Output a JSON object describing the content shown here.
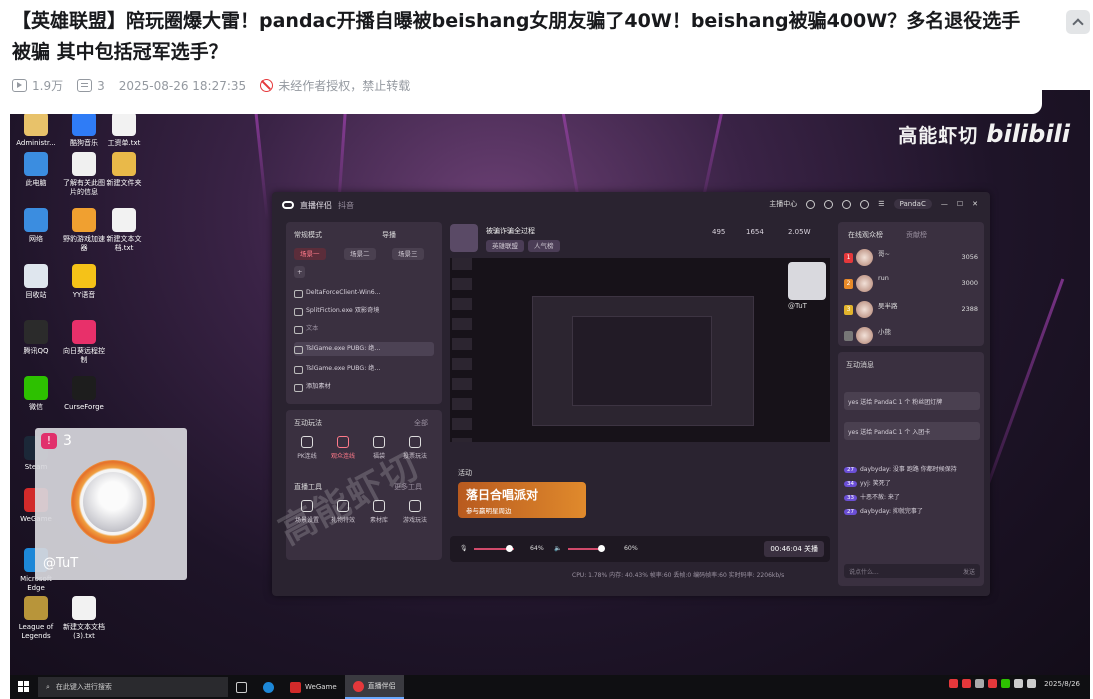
{
  "article": {
    "title": "【英雄联盟】陪玩圈爆大雷！pandac开播自曝被beishang女朋友骗了40W！beishang被骗400W？多名退役选手被骗 其中包括冠军选手？",
    "views": "1.9万",
    "danmaku_count": "3",
    "published": "2025-08-26 18:27:35",
    "copyright_notice": "未经作者授权，禁止转载"
  },
  "video": {
    "watermark": "高能虾切",
    "watermark_logo": "bilibili",
    "mid_watermark": "高能虾切",
    "desktop_icons": [
      {
        "label": "Administr...",
        "color": "#e8c26a"
      },
      {
        "label": "酷狗音乐",
        "color": "#2f7cf6"
      },
      {
        "label": "工资单.txt",
        "color": "#f2f2f2"
      },
      {
        "label": "此电脑",
        "color": "#3b8de0"
      },
      {
        "label": "了解有关此图片的信息",
        "color": "#f0f0f0"
      },
      {
        "label": "新建文件夹",
        "color": "#e9b949"
      },
      {
        "label": "网络",
        "color": "#3b8de0"
      },
      {
        "label": "野豹游戏加速器",
        "color": "#f0a030"
      },
      {
        "label": "新建文本文档.txt",
        "color": "#f2f2f2"
      },
      {
        "label": "回收站",
        "color": "#dfe6ee"
      },
      {
        "label": "YY语音",
        "color": "#f5c218"
      },
      {
        "label": "腾讯QQ",
        "color": "#2b2b2b"
      },
      {
        "label": "向日葵远程控制",
        "color": "#e8306a"
      },
      {
        "label": "微信",
        "color": "#2dc100"
      },
      {
        "label": "CurseForge",
        "color": "#1d1d1d"
      },
      {
        "label": "Steam",
        "color": "#1b2838"
      },
      {
        "label": "WeGame",
        "color": "#d22a2a"
      },
      {
        "label": "Microsoft Edge",
        "color": "#1d88d8"
      },
      {
        "label": "League of Legends",
        "color": "#b8953a"
      },
      {
        "label": "新建文本文档 (3).txt",
        "color": "#f2f2f2"
      }
    ],
    "avatar_card": {
      "viewer_count": "3",
      "name": "@TuT"
    },
    "app": {
      "title": "直播伴侣",
      "subtitle": "抖音",
      "title_right": [
        "主播中心",
        "PandaC"
      ],
      "mode_label": "常规模式",
      "guide_label": "导播",
      "scenes": [
        "场景一",
        "场景二",
        "场景三"
      ],
      "sources": [
        "DeltaForceClient-Win6...",
        "SplitFiction.exe 双影奇境",
        "文本",
        "TslGame.exe PUBG: 绝...",
        "TslGame.exe PUBG: 绝..."
      ],
      "add_source": "添加素材",
      "interaction_title": "互动玩法",
      "all_label": "全部",
      "interaction_tools": [
        "PK连线",
        "观众连线",
        "福袋",
        "投票玩法"
      ],
      "live_tools_title": "直播工具",
      "more_tools": "更多工具",
      "live_tools": [
        "场景设置",
        "礼物特效",
        "素材库",
        "游戏玩法"
      ],
      "stream_title": "被骗诈骗全过程",
      "tags": [
        "英雄联盟",
        "人气榜"
      ],
      "stats": [
        "495",
        "1654",
        "2.05W"
      ],
      "preview_user": "@TuT",
      "activity_label": "活动",
      "activity_banner_title": "落日合唱派对",
      "activity_banner_sub": "参与赢明星周边",
      "mic_volume": "64%",
      "speaker_volume": "60%",
      "timer": "00:46:04 关播",
      "status": "CPU: 1.78%  内存: 40.43%  帧率:60  丢帧:0  编码帧率:60  实时码率: 2206kb/s",
      "online_tab": "在线观众榜",
      "contribution_tab": "贡献榜",
      "viewers": [
        {
          "rank": "1",
          "name": "哥~",
          "score": "3056",
          "rank_color": "#e5383b"
        },
        {
          "rank": "2",
          "name": "run",
          "score": "3000",
          "rank_color": "#e98a28"
        },
        {
          "rank": "3",
          "name": "吴半路",
          "score": "2388",
          "rank_color": "#e2b42c"
        },
        {
          "rank": "",
          "name": "小熊",
          "score": "",
          "rank_color": "#777777"
        }
      ],
      "chat_title": "互动消息",
      "system_messages": [
        "yes 送给 PandaC 1 个 粉丝团灯牌",
        "yes 送给 PandaC 1 个 入团卡"
      ],
      "chat_messages": [
        {
          "badge": "27",
          "text": "daybyday: 没事 跑路 你都时候保持"
        },
        {
          "badge": "34",
          "text": "yyj: 笑死了"
        },
        {
          "badge": "33",
          "text": "十恶不赦: 来了"
        },
        {
          "badge": "27",
          "text": "daybyday: 抑就完事了"
        }
      ],
      "chat_placeholder": "说点什么...",
      "send_label": "发送"
    },
    "taskbar": {
      "search_placeholder": "在此键入进行搜索",
      "apps": [
        "WeGame",
        "直播伴侣"
      ],
      "date": "2025/8/26"
    }
  }
}
